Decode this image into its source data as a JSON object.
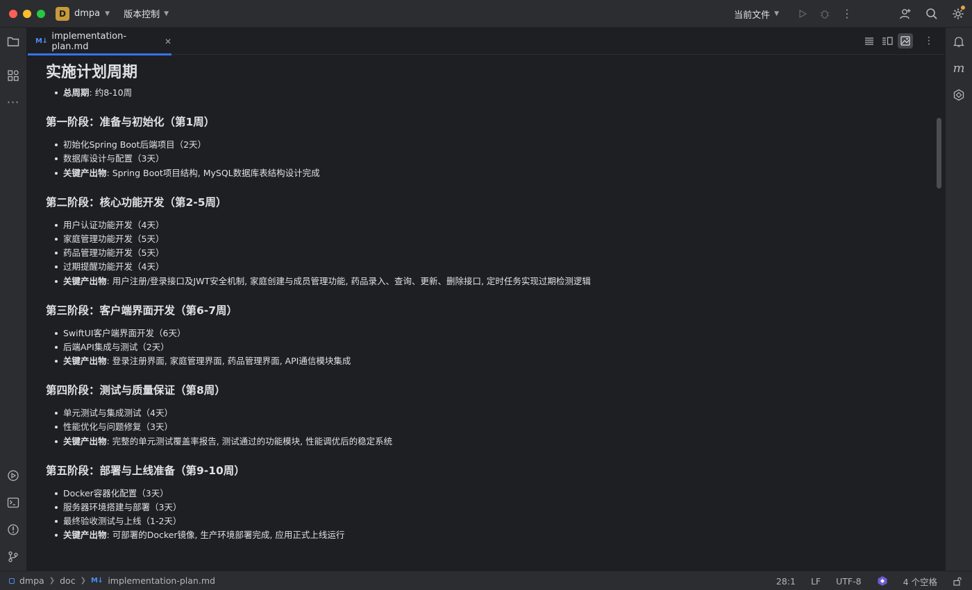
{
  "titlebar": {
    "project_initial": "D",
    "project_name": "dmpa",
    "vcs_label": "版本控制",
    "run_config": "当前文件"
  },
  "tab": {
    "badge": "M↓",
    "filename": "implementation-plan.md"
  },
  "doc": {
    "title": "实施计划周期",
    "summary": {
      "label": "总周期",
      "text": ": 约8-10周"
    },
    "phases": [
      {
        "heading": "第一阶段：准备与初始化（第1周）",
        "items": [
          "初始化Spring Boot后端项目（2天）",
          "数据库设计与配置（3天）"
        ],
        "deliverable_label": "关键产出物",
        "deliverable": ": Spring Boot项目结构, MySQL数据库表结构设计完成"
      },
      {
        "heading": "第二阶段：核心功能开发（第2-5周）",
        "items": [
          "用户认证功能开发（4天）",
          "家庭管理功能开发（5天）",
          "药品管理功能开发（5天）",
          "过期提醒功能开发（4天）"
        ],
        "deliverable_label": "关键产出物",
        "deliverable": ": 用户注册/登录接口及JWT安全机制, 家庭创建与成员管理功能, 药品录入、查询、更新、删除接口, 定时任务实现过期检测逻辑"
      },
      {
        "heading": "第三阶段：客户端界面开发（第6-7周）",
        "items": [
          "SwiftUI客户端界面开发（6天）",
          "后端API集成与测试（2天）"
        ],
        "deliverable_label": "关键产出物",
        "deliverable": ": 登录注册界面, 家庭管理界面, 药品管理界面, API通信模块集成"
      },
      {
        "heading": "第四阶段：测试与质量保证（第8周）",
        "items": [
          "单元测试与集成测试（4天）",
          "性能优化与问题修复（3天）"
        ],
        "deliverable_label": "关键产出物",
        "deliverable": ": 完整的单元测试覆盖率报告, 测试通过的功能模块, 性能调优后的稳定系统"
      },
      {
        "heading": "第五阶段：部署与上线准备（第9-10周）",
        "items": [
          "Docker容器化配置（3天）",
          "服务器环境搭建与部署（3天）",
          "最终验收测试与上线（1-2天）"
        ],
        "deliverable_label": "关键产出物",
        "deliverable": ": 可部署的Docker镜像, 生产环境部署完成, 应用正式上线运行"
      }
    ]
  },
  "statusbar": {
    "breadcrumb": [
      "dmpa",
      "doc",
      "implementation-plan.md"
    ],
    "position": "28:1",
    "line_sep": "LF",
    "encoding": "UTF-8",
    "indent": "4 个空格"
  },
  "colors": {
    "accent": "#3574f0",
    "background": "#1e1f22",
    "chrome": "#2b2d30",
    "project_badge": "#c79a3a"
  }
}
